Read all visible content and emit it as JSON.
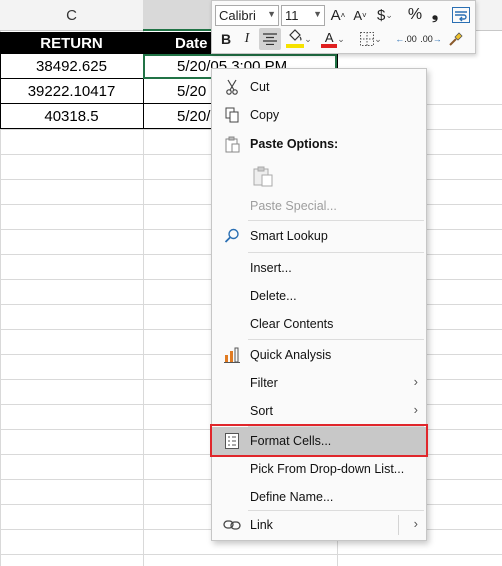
{
  "colors": {
    "accent_green": "#217346",
    "header_bg": "#000000",
    "header_text": "#ffffff",
    "highlight_red": "#e0262b",
    "menu_bg": "#fafafa",
    "hover_bg": "#c8c8c8"
  },
  "sheet": {
    "column_header": "C",
    "headers": {
      "return": "RETURN",
      "date": "Date"
    },
    "rows": [
      {
        "return": "38492.625",
        "date": "5/20/05 3:00 PM"
      },
      {
        "return": "39222.10417",
        "date": "5/20"
      },
      {
        "return": "40318.5",
        "date": "5/20/"
      }
    ]
  },
  "mini_toolbar": {
    "font_name": "Calibri",
    "font_size": "11",
    "grow_font": "A",
    "shrink_font": "A",
    "currency": "$",
    "percent": "%",
    "comma": "❟",
    "bold": "B",
    "italic": "I",
    "font_color_letter": "A",
    "decrease_decimal": ".00",
    "increase_decimal": ".00",
    "font_color_bar": "#e02020",
    "fill_color_bar": "#f6e200"
  },
  "context_menu": {
    "cut": "Cut",
    "copy": "Copy",
    "paste_options": "Paste Options:",
    "paste_special": "Paste Special...",
    "smart_lookup": "Smart Lookup",
    "insert": "Insert...",
    "delete": "Delete...",
    "clear_contents": "Clear Contents",
    "quick_analysis": "Quick Analysis",
    "filter": "Filter",
    "sort": "Sort",
    "format_cells": "Format Cells...",
    "pick_from_list": "Pick From Drop-down List...",
    "define_name": "Define Name...",
    "link": "Link",
    "submenu_arrow": "›"
  }
}
